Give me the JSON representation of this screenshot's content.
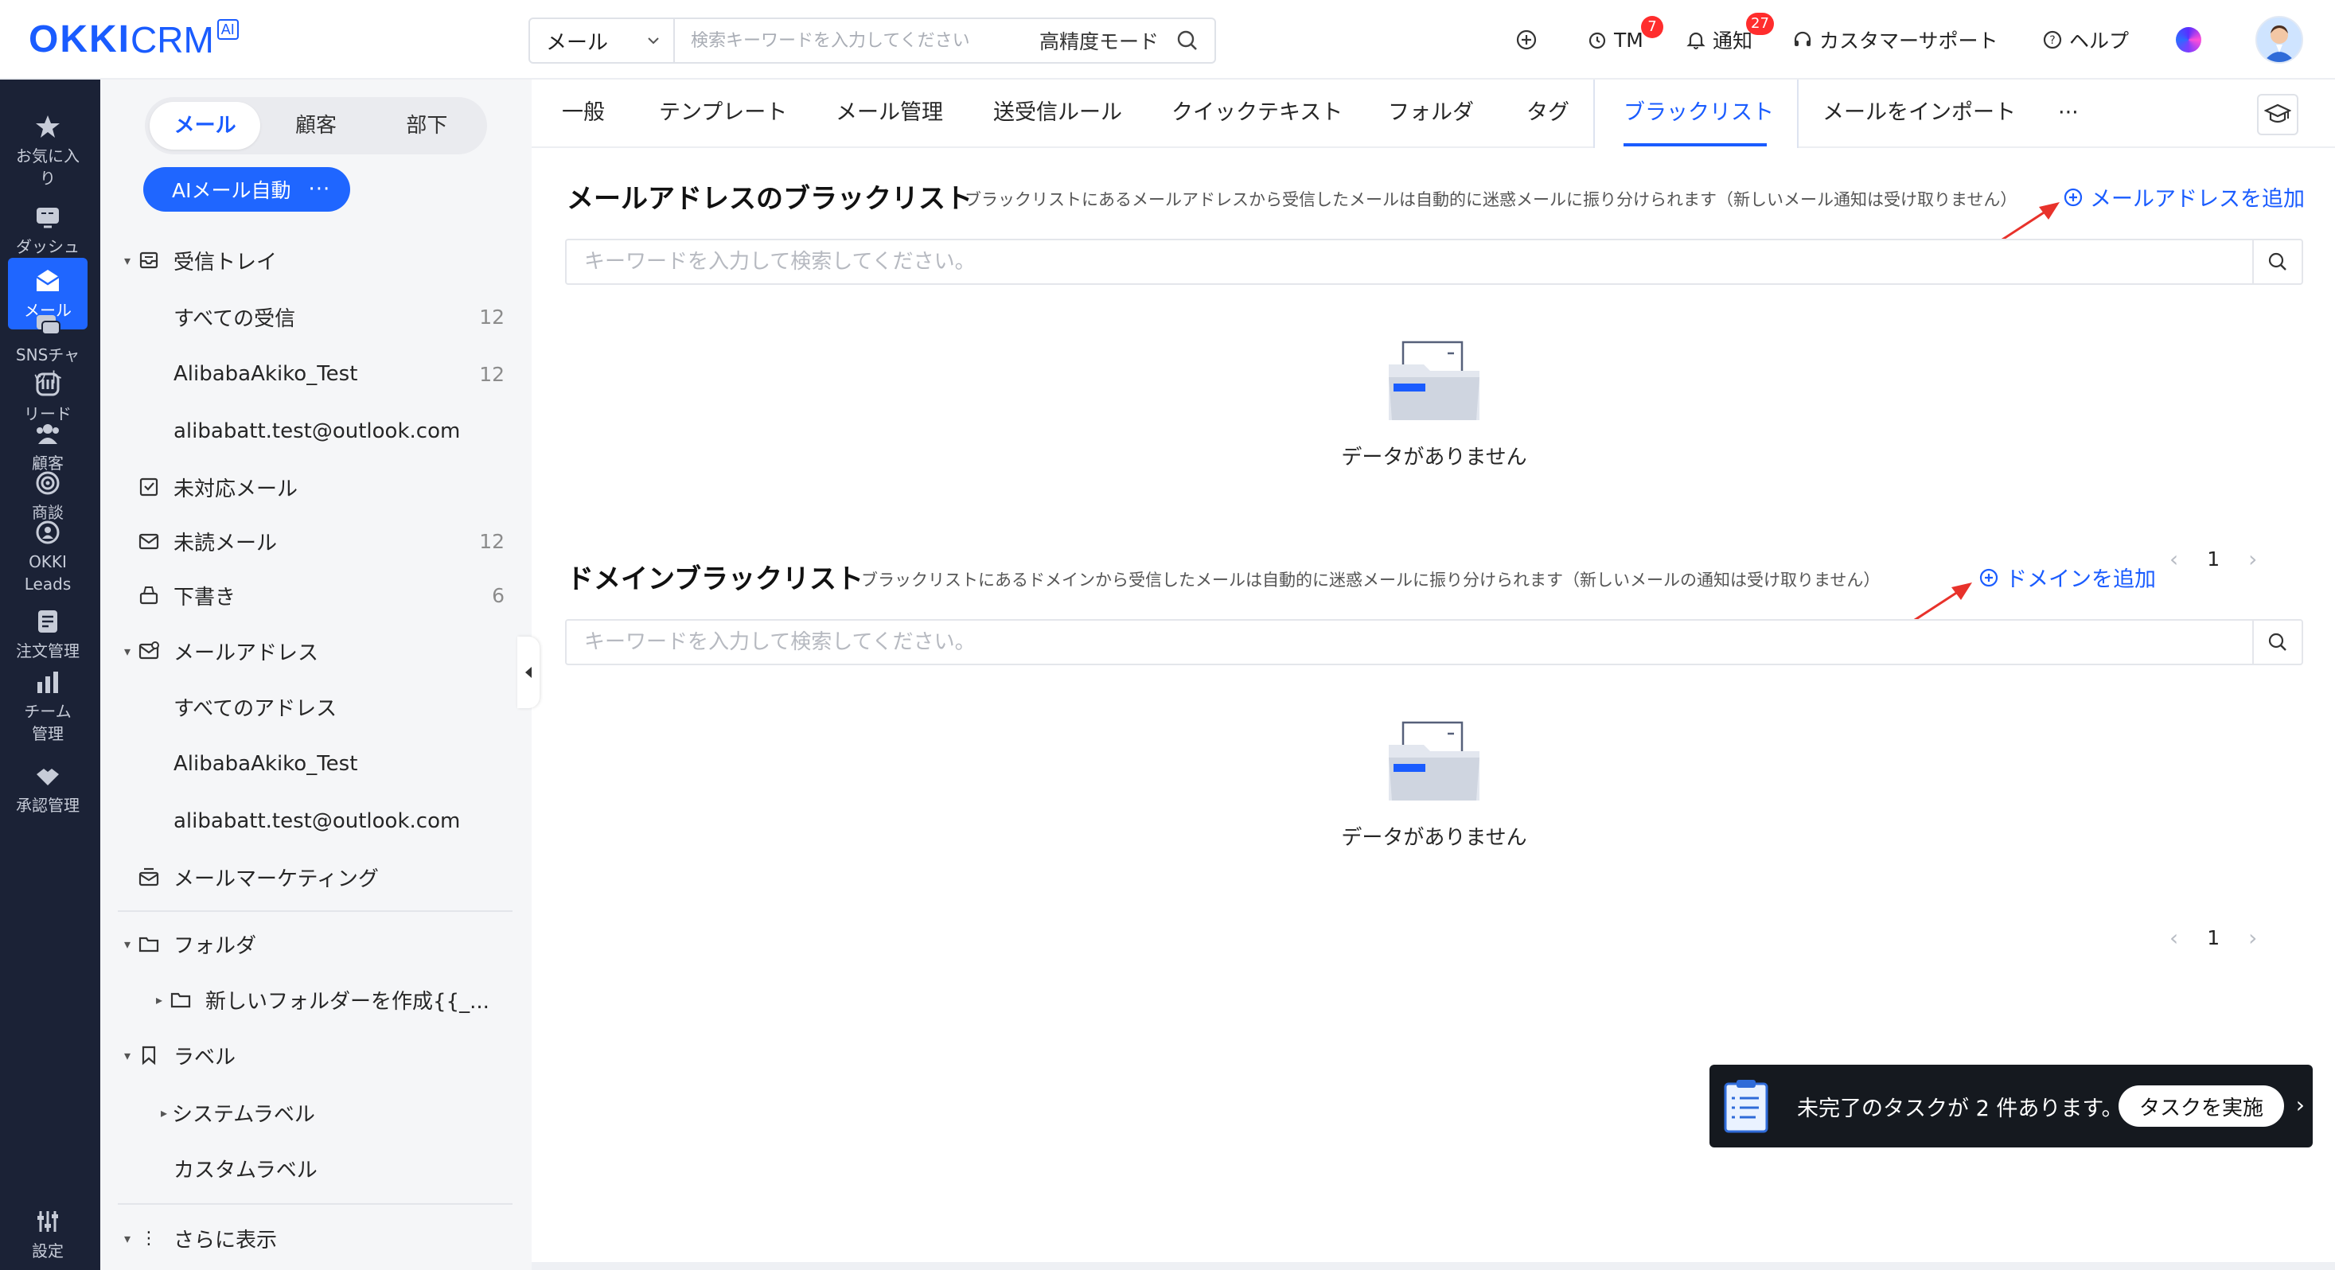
{
  "app": {
    "logo_main": "OKKI",
    "logo_sub": "CRM",
    "logo_badge": "AI"
  },
  "header": {
    "search_scope": "メール",
    "search_placeholder": "検索キーワードを入力してください",
    "precision_mode": "高精度モード",
    "tm_label": "TM",
    "tm_badge": "7",
    "notify_label": "通知",
    "notify_badge": "27",
    "support_label": "カスタマーサポート",
    "help_label": "ヘルプ"
  },
  "rail": [
    {
      "label": "お気に入り",
      "icon": "star-icon"
    },
    {
      "label": "ダッシュボード",
      "icon": "dashboard-icon"
    },
    {
      "label": "メール",
      "icon": "mail-icon"
    },
    {
      "label": "SNSチャット",
      "icon": "chat-icon"
    },
    {
      "label": "リード",
      "icon": "leads-icon"
    },
    {
      "label": "顧客",
      "icon": "customers-icon"
    },
    {
      "label": "商談",
      "icon": "target-icon"
    },
    {
      "label": "OKKI Leads",
      "icon": "okki-leads-icon"
    },
    {
      "label": "注文管理",
      "icon": "orders-icon"
    },
    {
      "label": "チーム管理",
      "icon": "team-icon"
    },
    {
      "label": "承認管理",
      "icon": "approval-icon"
    },
    {
      "label": "設定",
      "icon": "settings-icon"
    }
  ],
  "sidebar": {
    "segments": [
      "メール",
      "顧客",
      "部下"
    ],
    "active_segment": "メール",
    "ai_button": "AIメール自動",
    "ai_more": "···",
    "inbox": "受信トレイ",
    "inbox_items": [
      {
        "label": "すべての受信",
        "count": "12"
      },
      {
        "label": "AlibabaAkiko_Test",
        "count": "12"
      },
      {
        "label": "alibabatt.test@outlook.com",
        "count": ""
      }
    ],
    "unhandled": "未対応メール",
    "unread": "未読メール",
    "unread_count": "12",
    "drafts": "下書き",
    "drafts_count": "6",
    "addresses": "メールアドレス",
    "address_items": [
      "すべてのアドレス",
      "AlibabaAkiko_Test",
      "alibabatt.test@outlook.com"
    ],
    "marketing": "メールマーケティング",
    "folders": "フォルダ",
    "new_folder": "新しいフォルダーを作成{{_...",
    "labels": "ラベル",
    "system_labels": "システムラベル",
    "custom_labels": "カスタムラベル",
    "more": "さらに表示"
  },
  "tabs": [
    "一般",
    "テンプレート",
    "メール管理",
    "送受信ルール",
    "クイックテキスト",
    "フォルダ",
    "タグ",
    "ブラックリスト",
    "メールをインポート",
    "···"
  ],
  "active_tab": "ブラックリスト",
  "email_blacklist": {
    "title": "メールアドレスのブラックリスト",
    "desc": "ブラックリストにあるメールアドレスから受信したメールは自動的に迷惑メールに振り分けられます（新しいメール通知は受け取りません）",
    "add": "メールアドレスを追加",
    "placeholder": "キーワードを入力して検索してください。",
    "empty": "データがありません",
    "page": "1"
  },
  "domain_blacklist": {
    "title": "ドメインブラックリスト",
    "desc": "ブラックリストにあるドメインから受信したメールは自動的に迷惑メールに振り分けられます（新しいメールの通知は受け取りません）",
    "add": "ドメインを追加",
    "placeholder": "キーワードを入力して検索してください。",
    "empty": "データがありません",
    "page": "1"
  },
  "toast": {
    "message": "未完了のタスクが 2 件あります。",
    "button": "タスクを実施"
  },
  "colors": {
    "accent": "#1a5cff",
    "rail_bg": "#1b2236",
    "arrow": "#e8322b",
    "badge": "#ff2d2d"
  }
}
